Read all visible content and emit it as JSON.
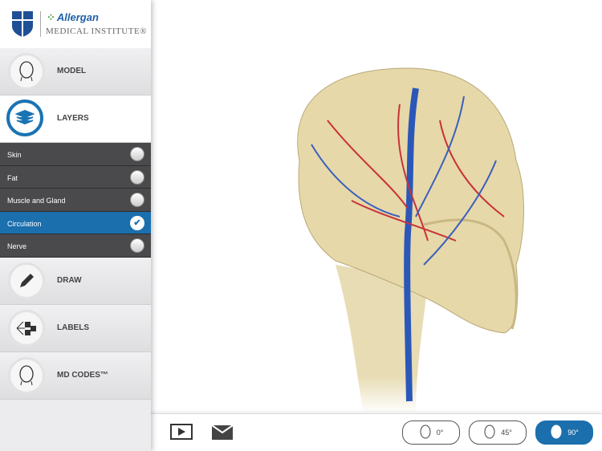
{
  "brand": {
    "name": "Allergan",
    "institute": "MEDICAL INSTITUTE®"
  },
  "tools": [
    {
      "label": "MODEL"
    },
    {
      "label": "LAYERS"
    },
    {
      "label": "DRAW"
    },
    {
      "label": "LABELS"
    },
    {
      "label": "MD CODES™"
    }
  ],
  "layers": [
    {
      "label": "Skin",
      "checked": false
    },
    {
      "label": "Fat",
      "checked": false
    },
    {
      "label": "Muscle and Gland",
      "checked": false
    },
    {
      "label": "Circulation",
      "checked": true
    },
    {
      "label": "Nerve",
      "checked": false
    }
  ],
  "check_glyph": "✔",
  "views": [
    {
      "label": "0°"
    },
    {
      "label": "45°"
    },
    {
      "label": "90°",
      "selected": true
    }
  ],
  "colors": {
    "accent": "#1b6fad"
  }
}
